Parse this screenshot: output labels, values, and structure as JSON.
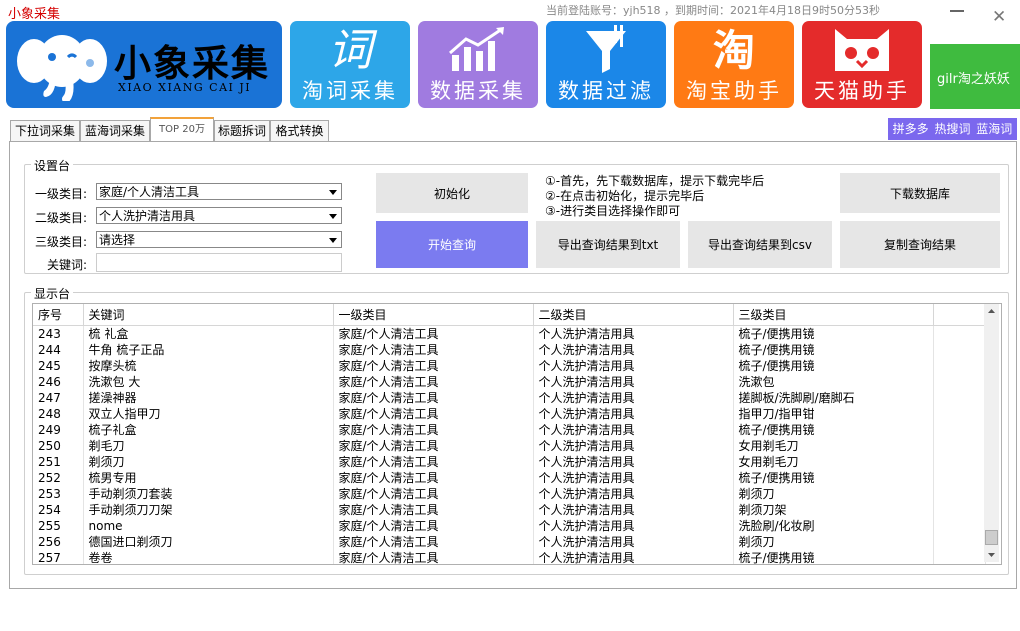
{
  "window": {
    "title": "小象采集",
    "account_info": "当前登陆账号：yjh518 ，到期时间：2021年4月18日9时50分53秒",
    "close_symbol": "✕"
  },
  "logo": {
    "title": "小象采集",
    "subtitle": "XIAO XIANG CAI JI"
  },
  "tiles": [
    {
      "label": "淘词采集",
      "icon": "词",
      "color": "#2da6e8"
    },
    {
      "label": "数据采集",
      "icon": "chart-icon",
      "color": "#a07be0"
    },
    {
      "label": "数据过滤",
      "icon": "funnel-icon",
      "color": "#1b87e8"
    },
    {
      "label": "淘宝助手",
      "icon": "淘",
      "color": "#ff7a14"
    },
    {
      "label": "天猫助手",
      "icon": "tmall-icon",
      "color": "#e42b2b"
    }
  ],
  "side_tile": {
    "label": "gilr淘之妖妖"
  },
  "purple_links": "拼多多 热搜词 蓝海词",
  "tabs": [
    "下拉词采集",
    "蓝海词采集",
    "TOP 20万",
    "标题拆词",
    "格式转换"
  ],
  "settings": {
    "group_title": "设置台",
    "level1_label": "一级类目:",
    "level1_value": "家庭/个人清洁工具",
    "level2_label": "二级类目:",
    "level2_value": "个人洗护清洁用具",
    "level3_label": "三级类目:",
    "level3_value": "请选择",
    "keyword_label": "关键词:",
    "keyword_value": "",
    "buttons": {
      "init": "初始化",
      "start": "开始查询",
      "download_db": "下载数据库",
      "export_txt": "导出查询结果到txt",
      "export_csv": "导出查询结果到csv",
      "copy": "复制查询结果"
    },
    "instructions": [
      "①-首先，先下载数据库，提示下载完毕后",
      "②-在点击初始化，提示完毕后",
      "③-进行类目选择操作即可"
    ]
  },
  "display": {
    "group_title": "显示台",
    "columns": [
      "序号",
      "关键词",
      "一级类目",
      "二级类目",
      "三级类目"
    ],
    "rows": [
      [
        "243",
        "梳 礼盒",
        "家庭/个人清洁工具",
        "个人洗护清洁用具",
        "梳子/便携用镜"
      ],
      [
        "244",
        "牛角 梳子正品",
        "家庭/个人清洁工具",
        "个人洗护清洁用具",
        "梳子/便携用镜"
      ],
      [
        "245",
        "按摩头梳",
        "家庭/个人清洁工具",
        "个人洗护清洁用具",
        "梳子/便携用镜"
      ],
      [
        "246",
        "洗漱包 大",
        "家庭/个人清洁工具",
        "个人洗护清洁用具",
        "洗漱包"
      ],
      [
        "247",
        "搓澡神器",
        "家庭/个人清洁工具",
        "个人洗护清洁用具",
        "搓脚板/洗脚刷/磨脚石"
      ],
      [
        "248",
        "双立人指甲刀",
        "家庭/个人清洁工具",
        "个人洗护清洁用具",
        "指甲刀/指甲钳"
      ],
      [
        "249",
        "梳子礼盒",
        "家庭/个人清洁工具",
        "个人洗护清洁用具",
        "梳子/便携用镜"
      ],
      [
        "250",
        "剃毛刀",
        "家庭/个人清洁工具",
        "个人洗护清洁用具",
        "女用剃毛刀"
      ],
      [
        "251",
        "剃须刀",
        "家庭/个人清洁工具",
        "个人洗护清洁用具",
        "女用剃毛刀"
      ],
      [
        "252",
        "梳男专用",
        "家庭/个人清洁工具",
        "个人洗护清洁用具",
        "梳子/便携用镜"
      ],
      [
        "253",
        "手动剃须刀套装",
        "家庭/个人清洁工具",
        "个人洗护清洁用具",
        "剃须刀"
      ],
      [
        "254",
        "手动剃须刀刀架",
        "家庭/个人清洁工具",
        "个人洗护清洁用具",
        "剃须刀架"
      ],
      [
        "255",
        "nome",
        "家庭/个人清洁工具",
        "个人洗护清洁用具",
        "洗脸刷/化妆刷"
      ],
      [
        "256",
        "德国进口剃须刀",
        "家庭/个人清洁工具",
        "个人洗护清洁用具",
        "剃须刀"
      ],
      [
        "257",
        "卷卷",
        "家庭/个人清洁工具",
        "个人洗护清洁用具",
        "梳子/便携用镜"
      ]
    ]
  },
  "colors": {
    "title_red": "#d40000",
    "logo_blue": "#1a73d6",
    "primary_button": "#7b7bf0",
    "side_tile_green": "#3fbb3f",
    "tab_active_accent": "#f2a23a"
  }
}
